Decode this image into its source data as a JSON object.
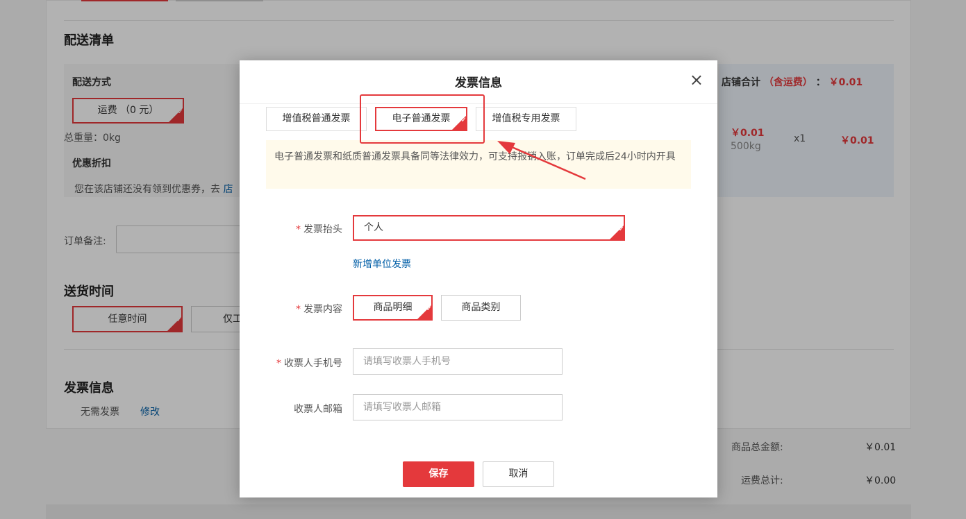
{
  "page": {
    "shipping_list_title": "配送清单",
    "delivery_method_label": "配送方式",
    "shipping_fee_option": "运费 （0 元）",
    "total_weight": "总重量：0kg",
    "discount_title": "优惠折扣",
    "coupon_notice": "您在该店铺还没有领到优惠券，去",
    "coupon_link": "店",
    "store_total_label": "店铺合计",
    "store_total_freight_note": "（含运费）",
    "store_total_colon": "：",
    "store_total_value": "￥0.01",
    "item_price": "￥0.01",
    "item_weight": "500kg",
    "item_qty": "x1",
    "item_subtotal": "￥0.01",
    "order_note_label": "订单备注:",
    "delivery_time_title": "送货时间",
    "delivery_time_any": "任意时间",
    "delivery_time_other": "仅工",
    "invoice_title": "发票信息",
    "invoice_status": "无需发票",
    "invoice_modify": "修改",
    "goods_total_label": "商品总金额:",
    "goods_total_value": "￥0.01",
    "freight_total_label": "运费总计:",
    "freight_total_value": "￥0.00"
  },
  "modal": {
    "title": "发票信息",
    "close_symbol": "×",
    "tabs": [
      {
        "label": "增值税普通发票"
      },
      {
        "label": "电子普通发票"
      },
      {
        "label": "增值税专用发票"
      }
    ],
    "notice": "电子普通发票和纸质普通发票具备同等法律效力，可支持报销入账，订单完成后24小时内开具",
    "required_mark": "*",
    "invoice_header_label": "发票抬头",
    "invoice_header_value": "个人",
    "add_company_invoice": "新增单位发票",
    "invoice_content_label": "发票内容",
    "content_options": [
      {
        "label": "商品明细"
      },
      {
        "label": "商品类别"
      }
    ],
    "phone_label": "收票人手机号",
    "phone_placeholder": "请填写收票人手机号",
    "email_label": "收票人邮箱",
    "email_placeholder": "请填写收票人邮箱",
    "save_label": "保存",
    "cancel_label": "取消"
  },
  "colors": {
    "accent": "#e4393c",
    "link": "#005ea7",
    "notice_bg": "#fffaeb"
  }
}
